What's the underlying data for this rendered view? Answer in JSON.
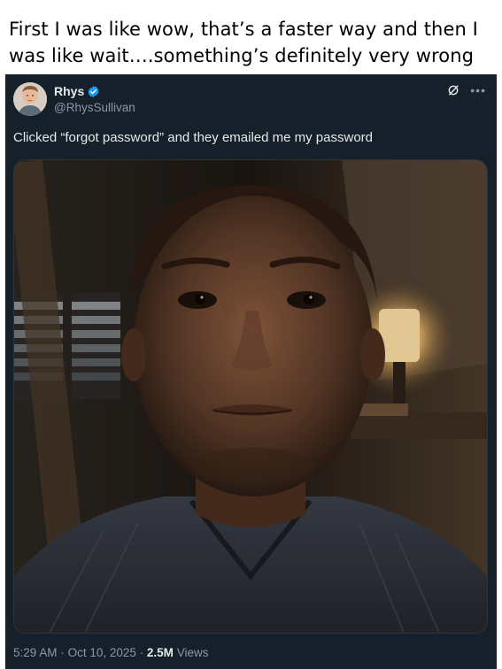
{
  "caption": {
    "line1": "First I was like wow, that’s a faster way and then I",
    "line2": "was like wait….something’s definitely very wrong"
  },
  "tweet": {
    "author_name": "Rhys",
    "author_handle": "@RhysSullivan",
    "verified": true,
    "text": "Clicked “forgot password” and they emailed me my password",
    "time": "5:29 AM",
    "date": "Oct 10, 2025",
    "separator": "·",
    "views_count": "2.5M",
    "views_label": "Views",
    "icons": [
      "avatar",
      "verified-badge-icon",
      "grok-icon",
      "more-options-icon"
    ],
    "colors": {
      "background": "#15202b",
      "text": "#e7e9ea",
      "muted": "#8b98a5",
      "verified": "#1d9bf0"
    }
  }
}
